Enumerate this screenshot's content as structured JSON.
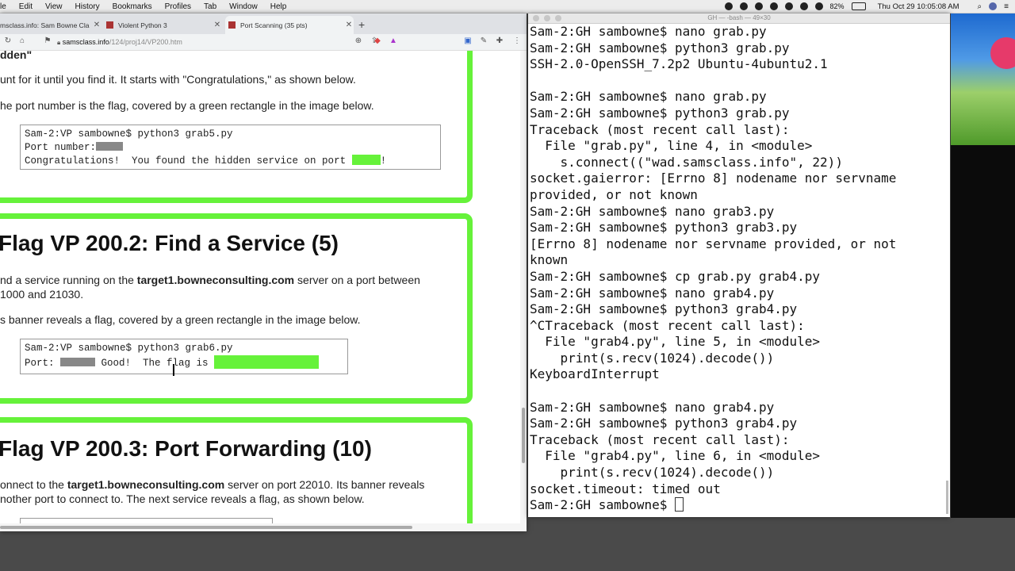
{
  "menubar": {
    "items": [
      "le",
      "Edit",
      "View",
      "History",
      "Bookmarks",
      "Profiles",
      "Tab",
      "Window",
      "Help"
    ],
    "battery": "82%",
    "clock": "Thu Oct 29  10:05:08 AM"
  },
  "browser": {
    "tabs": [
      {
        "label": "msclass.info: Sam Bowne Cla",
        "active": false
      },
      {
        "label": "Violent Python 3",
        "active": false
      },
      {
        "label": "Port Scanning (35 pts)",
        "active": true
      }
    ],
    "url_host": "samsclass.info",
    "url_path": "/124/proj14/VP200.htm"
  },
  "page": {
    "s1_heading_tail": "dden\"",
    "s1_p1": "unt for it until you find it. It starts with \"Congratulations,\" as shown below.",
    "s1_p2": "he port number is the flag, covered by a green rectangle in the image below.",
    "s1_code": [
      "Sam-2:VP sambowne$ python3 grab5.py",
      "Port number:",
      "Congratulations!  You found the hidden service on port ",
      "!"
    ],
    "s2_title": "Flag VP 200.2: Find a Service (5)",
    "s2_p1_a": "nd a service running on the ",
    "s2_p1_b": "target1.bowneconsulting.com",
    "s2_p1_c": " server on a port between",
    "s2_p1_d": "1000 and 21030.",
    "s2_p2": "s banner reveals a flag, covered by a green rectangle in the image below.",
    "s2_code": [
      "Sam-2:VP sambowne$ python3 grab6.py",
      "Port: ",
      " Good!  The flag is "
    ],
    "s3_title": "Flag VP 200.3: Port Forwarding (10)",
    "s3_p1_a": "onnect to the ",
    "s3_p1_b": "target1.bowneconsulting.com",
    "s3_p1_c": " server on port 22010. Its banner reveals",
    "s3_p1_d": "nother port to connect to. The next service reveals a flag, as shown below."
  },
  "terminal": {
    "title": "GH — -bash — 49×30",
    "lines": [
      "Sam-2:GH sambowne$ nano grab.py",
      "Sam-2:GH sambowne$ python3 grab.py",
      "SSH-2.0-OpenSSH_7.2p2 Ubuntu-4ubuntu2.1",
      "",
      "Sam-2:GH sambowne$ nano grab.py",
      "Sam-2:GH sambowne$ python3 grab.py",
      "Traceback (most recent call last):",
      "  File \"grab.py\", line 4, in <module>",
      "    s.connect((\"wad.samsclass.info\", 22))",
      "socket.gaierror: [Errno 8] nodename nor servname",
      "provided, or not known",
      "Sam-2:GH sambowne$ nano grab3.py",
      "Sam-2:GH sambowne$ python3 grab3.py",
      "[Errno 8] nodename nor servname provided, or not",
      "known",
      "Sam-2:GH sambowne$ cp grab.py grab4.py",
      "Sam-2:GH sambowne$ nano grab4.py",
      "Sam-2:GH sambowne$ python3 grab4.py",
      "^CTraceback (most recent call last):",
      "  File \"grab4.py\", line 5, in <module>",
      "    print(s.recv(1024).decode())",
      "KeyboardInterrupt",
      "",
      "Sam-2:GH sambowne$ nano grab4.py",
      "Sam-2:GH sambowne$ python3 grab4.py",
      "Traceback (most recent call last):",
      "  File \"grab4.py\", line 6, in <module>",
      "    print(s.recv(1024).decode())",
      "socket.timeout: timed out",
      "Sam-2:GH sambowne$ "
    ]
  },
  "colors": {
    "flag_green": "#66f23a",
    "redact_gray": "#888888"
  }
}
